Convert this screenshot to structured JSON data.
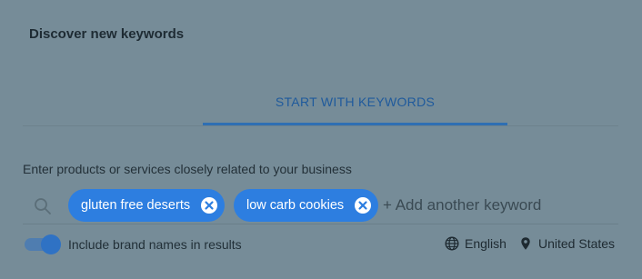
{
  "header": {
    "title": "Discover new keywords"
  },
  "tabs": [
    {
      "label": "START WITH KEYWORDS"
    }
  ],
  "form": {
    "hint": "Enter products or services closely related to your business",
    "keywords": [
      {
        "label": "gluten free deserts"
      },
      {
        "label": "low carb cookies"
      }
    ],
    "add_placeholder": "+ Add another keyword"
  },
  "options": {
    "brand_toggle_label": "Include brand names in results",
    "brand_toggle_on": true,
    "language": "English",
    "location": "United States"
  },
  "icons": {
    "search": "search-icon",
    "chip_close": "close-circle-icon",
    "language": "globe-icon",
    "location": "location-pin-icon"
  },
  "colors": {
    "chip_background": "#2d7ee0",
    "tab_accent": "#2f6fb3",
    "toggle_on": "#2f72c4"
  }
}
